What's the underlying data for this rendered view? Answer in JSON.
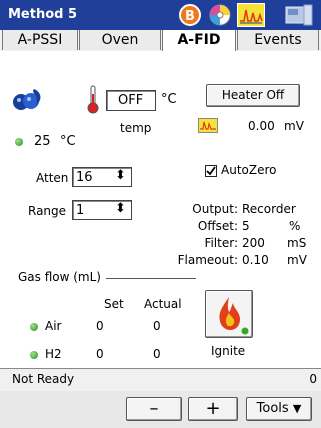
{
  "window": {
    "title": "Method 5"
  },
  "tabs": [
    {
      "label": "A-PSSI",
      "active": false
    },
    {
      "label": "Oven",
      "active": false
    },
    {
      "label": "A-FID",
      "active": true
    },
    {
      "label": "Events",
      "active": false
    }
  ],
  "detector": {
    "temp_field_value": "OFF",
    "temp_unit": "°C",
    "temp_label": "temp",
    "actual_temp": "25",
    "actual_temp_unit": "°C",
    "heater_button_label": "Heater Off",
    "signal_value": "0.00",
    "signal_unit": "mV",
    "atten_label": "Atten",
    "atten_value": "16",
    "range_label": "Range",
    "range_value": "1",
    "autozero_label": "AutoZero",
    "autozero_checked": true
  },
  "output_info": {
    "output_label": "Output:",
    "output_value": "Recorder",
    "offset_label": "Offset:",
    "offset_value": "5",
    "offset_unit": "%",
    "filter_label": "Filter:",
    "filter_value": "200",
    "filter_unit": "mS",
    "flameout_label": "Flameout:",
    "flameout_value": "0.10",
    "flameout_unit": "mV"
  },
  "gas_flow": {
    "title": "Gas flow (mL)",
    "set_header": "Set",
    "actual_header": "Actual",
    "rows": [
      {
        "name": "Air",
        "set": "0",
        "actual": "0"
      },
      {
        "name": "H2",
        "set": "0",
        "actual": "0"
      }
    ],
    "ignite_label": "Ignite"
  },
  "status": {
    "text": "Not Ready",
    "count": "0"
  },
  "bottom_bar": {
    "minus_label": "–",
    "plus_label": "+",
    "tools_label": "Tools"
  },
  "colors": {
    "titlebar": "#1f3f9a",
    "led_green": "#3aa52a",
    "flame_red": "#e0401a",
    "selection_blue": "#1f3f9a"
  }
}
